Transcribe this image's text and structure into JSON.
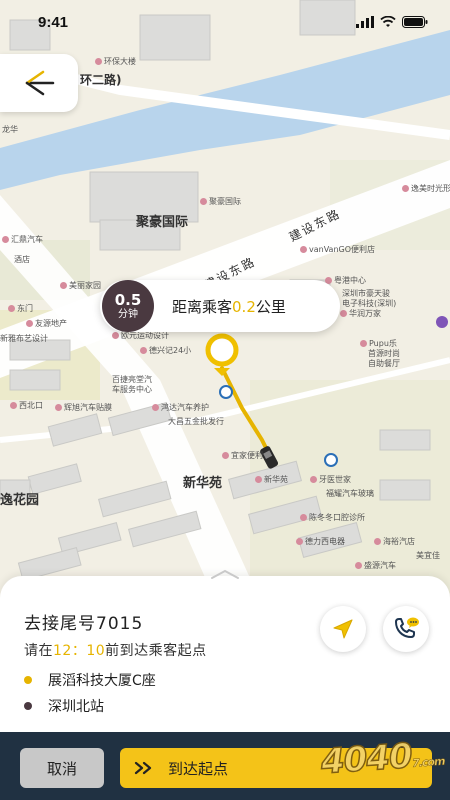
{
  "status_bar": {
    "time": "9:41"
  },
  "map": {
    "labels": {
      "huanbao": "环保大楼",
      "ring_road": "环二路)",
      "long_hua": "龙华",
      "juhao_small": "聚豪国际",
      "juhao_big": "聚豪国际",
      "jianshe_east_1": "建设东路",
      "jianshe_east_2": "建设东路",
      "vanvango": "vanVanGO便利店",
      "yimei": "逸美时光形",
      "huiding": "汇鼎汽车",
      "jiudian": "酒店",
      "meilan": "美丽家园",
      "yuehe": "粤港中心",
      "shenzhou": "深圳市豪天骏",
      "dianzi": "电子科技(深圳)",
      "huarun": "华润万家",
      "dongmen": "东门",
      "youyuan": "友源地产",
      "yishu": "新雅布艺设计",
      "oulang": "欧元运动设计",
      "dexing": "德兴记24小",
      "pupu": "Pupu乐",
      "shouyuan": "首源时尚",
      "zizhu": "自助餐厅",
      "baishi": "百捷亮堂汽",
      "baishi2": "车服务中心",
      "xibei": "西北口",
      "huitu": "辉旭汽车贴膜",
      "hongdao": "鸿达汽车养护",
      "dachang": "大昌五金批发行",
      "yijia": "宜家便利",
      "xinhua": "新华苑",
      "xinhua2": "新华苑",
      "yachi": "牙医世家",
      "fuqiu": "福耀汽车玻璃",
      "chenwei": "陈冬冬口腔诊所",
      "yiyuan": "逸花园",
      "defang": "德力西电器",
      "haigu": "海裕汽店",
      "meiyi": "美宜佳",
      "gaoma": "盛源汽车"
    }
  },
  "eta": {
    "value": "0.5",
    "unit": "分钟"
  },
  "distance": {
    "prefix": "距离乘客",
    "value": "0.2",
    "suffix": "公里"
  },
  "trip": {
    "title": "去接尾号7015",
    "arrive_prefix": "请在",
    "arrive_time": "12：10",
    "arrive_suffix": "前到达乘客起点",
    "pickup_address": "展滔科技大厦C座",
    "dropoff_address": "深圳北站"
  },
  "actions": {
    "cancel_label": "取消",
    "arrive_label": "到达起点"
  },
  "watermark": {
    "text": "4040",
    "suffix": "7.com"
  },
  "colors": {
    "accent": "#f4c318",
    "pickup_dot": "#e6b400",
    "dropoff_dot": "#4a3940",
    "bar": "#203142"
  }
}
